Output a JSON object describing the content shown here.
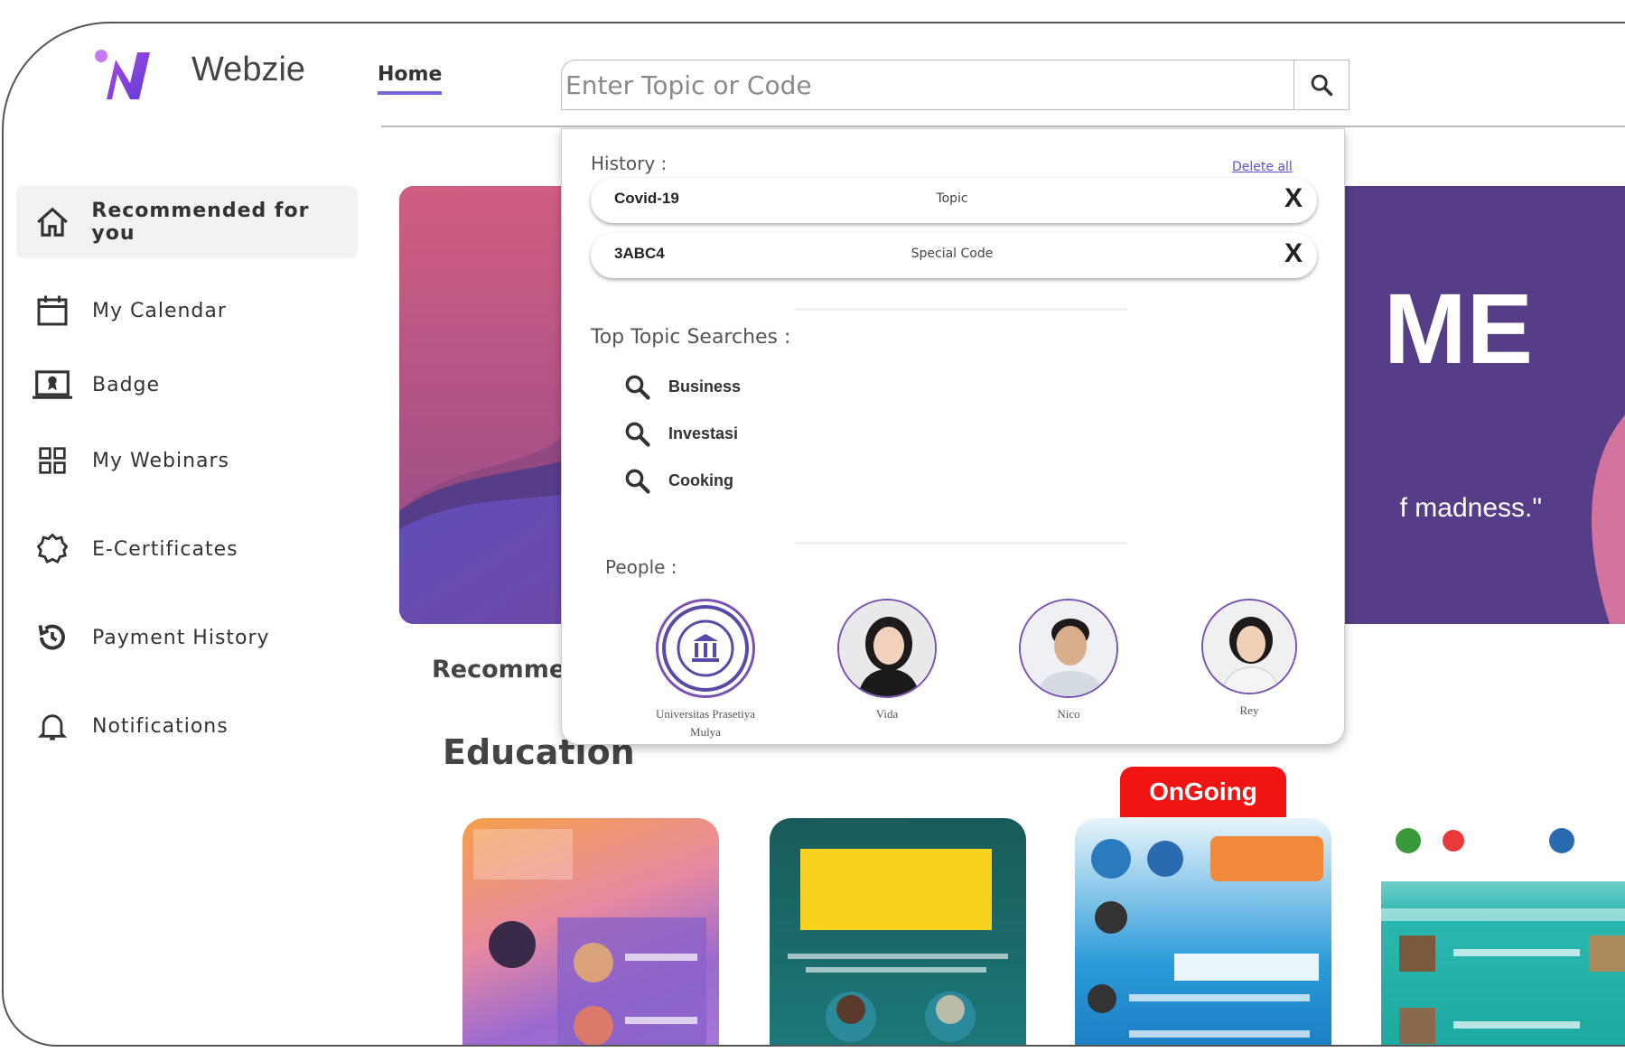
{
  "app": {
    "brand": "Webzie"
  },
  "nav": {
    "home": "Home"
  },
  "search": {
    "placeholder": "Enter Topic or Code"
  },
  "sidebar": {
    "items": [
      {
        "label": "Recommended for you",
        "icon": "home-icon"
      },
      {
        "label": "My Calendar",
        "icon": "calendar-icon"
      },
      {
        "label": "Badge",
        "icon": "badge-icon"
      },
      {
        "label": "My Webinars",
        "icon": "grid-icon"
      },
      {
        "label": "E-Certificates",
        "icon": "certificate-icon"
      },
      {
        "label": "Payment History",
        "icon": "history-icon"
      },
      {
        "label": "Notifications",
        "icon": "bell-icon"
      }
    ]
  },
  "banner": {
    "big_text": "ME",
    "quote": "f madness.\""
  },
  "sections": {
    "recommended": "Recommen",
    "education": "Education"
  },
  "cards": {
    "ongoing_badge": "OnGoing"
  },
  "dropdown": {
    "history_label": "History :",
    "delete_all": "Delete all",
    "history": [
      {
        "term": "Covid-19",
        "type": "Topic",
        "remove": "X"
      },
      {
        "term": "3ABC4",
        "type": "Special Code",
        "remove": "X"
      }
    ],
    "top_label": "Top Topic Searches :",
    "topics": [
      "Business",
      "Investasi",
      "Cooking"
    ],
    "people_label": "People :",
    "people": [
      {
        "name": "Universitas Prasetiya Mulya"
      },
      {
        "name": "Vida"
      },
      {
        "name": "Nico"
      },
      {
        "name": "Rey"
      }
    ]
  },
  "colors": {
    "accent": "#7468d6",
    "ongoing": "#f21313",
    "banner": "#5a3f8c"
  }
}
